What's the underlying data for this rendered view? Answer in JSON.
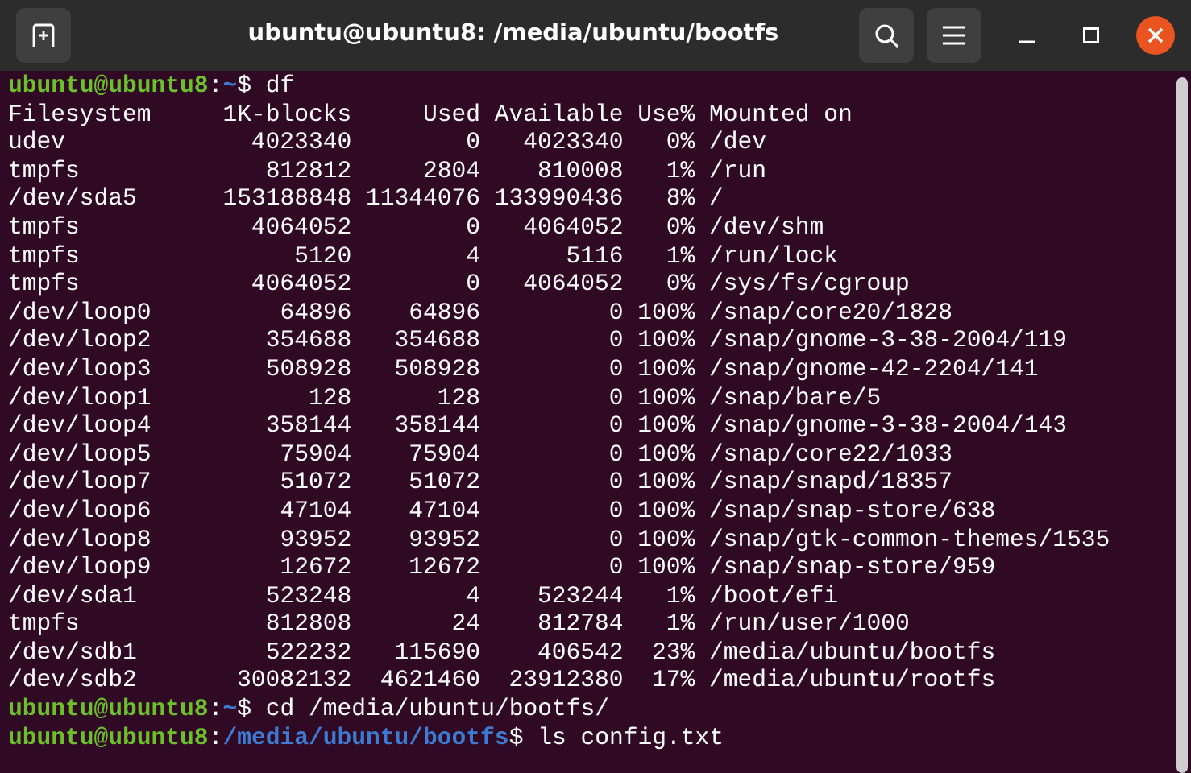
{
  "window": {
    "title": "ubuntu@ubuntu8: /media/ubuntu/bootfs"
  },
  "terminal": [
    {
      "kind": "prompt",
      "user": "ubuntu@ubuntu8",
      "separator": ":",
      "path": "~",
      "symbol": "$",
      "command": "df"
    },
    {
      "kind": "table",
      "columns": [
        "Filesystem",
        "1K-blocks",
        "Used",
        "Available",
        "Use%",
        "Mounted on"
      ],
      "rows": [
        [
          "udev",
          "4023340",
          "0",
          "4023340",
          "0%",
          "/dev"
        ],
        [
          "tmpfs",
          "812812",
          "2804",
          "810008",
          "1%",
          "/run"
        ],
        [
          "/dev/sda5",
          "153188848",
          "11344076",
          "133990436",
          "8%",
          "/"
        ],
        [
          "tmpfs",
          "4064052",
          "0",
          "4064052",
          "0%",
          "/dev/shm"
        ],
        [
          "tmpfs",
          "5120",
          "4",
          "5116",
          "1%",
          "/run/lock"
        ],
        [
          "tmpfs",
          "4064052",
          "0",
          "4064052",
          "0%",
          "/sys/fs/cgroup"
        ],
        [
          "/dev/loop0",
          "64896",
          "64896",
          "0",
          "100%",
          "/snap/core20/1828"
        ],
        [
          "/dev/loop2",
          "354688",
          "354688",
          "0",
          "100%",
          "/snap/gnome-3-38-2004/119"
        ],
        [
          "/dev/loop3",
          "508928",
          "508928",
          "0",
          "100%",
          "/snap/gnome-42-2204/141"
        ],
        [
          "/dev/loop1",
          "128",
          "128",
          "0",
          "100%",
          "/snap/bare/5"
        ],
        [
          "/dev/loop4",
          "358144",
          "358144",
          "0",
          "100%",
          "/snap/gnome-3-38-2004/143"
        ],
        [
          "/dev/loop5",
          "75904",
          "75904",
          "0",
          "100%",
          "/snap/core22/1033"
        ],
        [
          "/dev/loop7",
          "51072",
          "51072",
          "0",
          "100%",
          "/snap/snapd/18357"
        ],
        [
          "/dev/loop6",
          "47104",
          "47104",
          "0",
          "100%",
          "/snap/snap-store/638"
        ],
        [
          "/dev/loop8",
          "93952",
          "93952",
          "0",
          "100%",
          "/snap/gtk-common-themes/1535"
        ],
        [
          "/dev/loop9",
          "12672",
          "12672",
          "0",
          "100%",
          "/snap/snap-store/959"
        ],
        [
          "/dev/sda1",
          "523248",
          "4",
          "523244",
          "1%",
          "/boot/efi"
        ],
        [
          "tmpfs",
          "812808",
          "24",
          "812784",
          "1%",
          "/run/user/1000"
        ],
        [
          "/dev/sdb1",
          "522232",
          "115690",
          "406542",
          "23%",
          "/media/ubuntu/bootfs"
        ],
        [
          "/dev/sdb2",
          "30082132",
          "4621460",
          "23912380",
          "17%",
          "/media/ubuntu/rootfs"
        ]
      ]
    },
    {
      "kind": "prompt",
      "user": "ubuntu@ubuntu8",
      "separator": ":",
      "path": "~",
      "symbol": "$",
      "command": "cd /media/ubuntu/bootfs/"
    },
    {
      "kind": "prompt",
      "user": "ubuntu@ubuntu8",
      "separator": ":",
      "path": "/media/ubuntu/bootfs",
      "symbol": "$",
      "command": "ls config.txt"
    }
  ]
}
